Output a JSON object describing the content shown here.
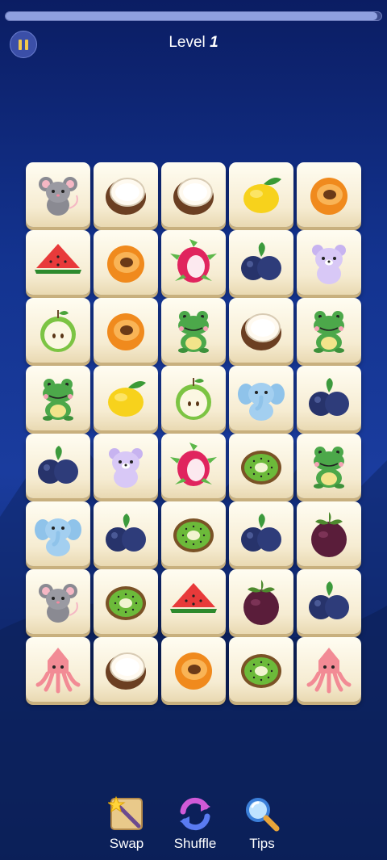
{
  "header": {
    "level_label": "Level",
    "level_value": "1",
    "progress": 0.99
  },
  "board": {
    "rows": [
      [
        "mouse",
        "coconut",
        "coconut",
        "lemon",
        "apricot"
      ],
      [
        "watermelon",
        "apricot",
        "dragonfruit",
        "blueberry",
        "bear"
      ],
      [
        "apple",
        "apricot",
        "frog",
        "coconut",
        "frog"
      ],
      [
        "frog",
        "lemon",
        "apple",
        "elephant",
        "blueberry"
      ],
      [
        "blueberry",
        "bear",
        "dragonfruit",
        "kiwi",
        "frog"
      ],
      [
        "elephant",
        "blueberry",
        "kiwi",
        "blueberry",
        "mangosteen"
      ],
      [
        "mouse",
        "kiwi",
        "watermelon",
        "mangosteen",
        "blueberry"
      ],
      [
        "squid",
        "coconut",
        "apricot",
        "kiwi",
        "squid"
      ]
    ]
  },
  "toolbar": {
    "swap_label": "Swap",
    "shuffle_label": "Shuffle",
    "tips_label": "Tips"
  },
  "icons": {
    "pause": "pause-icon",
    "swap": "magic-wand-icon",
    "shuffle": "shuffle-arrows-icon",
    "tips": "magnifier-icon"
  }
}
